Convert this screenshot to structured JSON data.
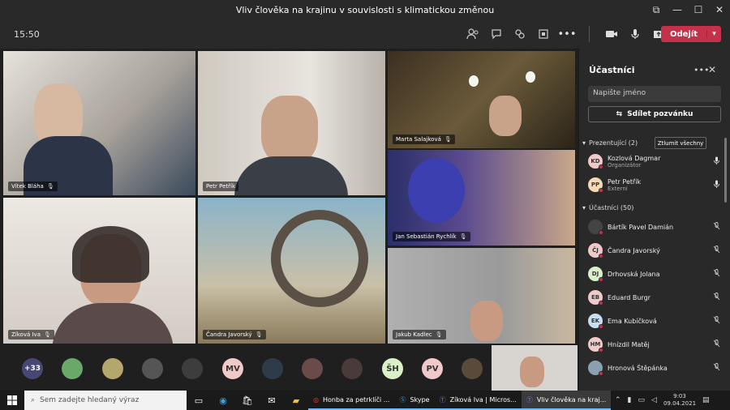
{
  "window": {
    "title": "Vliv člověka na krajinu v souvislosti s klimatickou změnou",
    "controls": [
      "⧉",
      "—",
      "☐",
      "✕"
    ]
  },
  "toolbar": {
    "time": "15:50",
    "leave_label": "Odejít"
  },
  "video_tiles": [
    {
      "name": "Vítek Bláha",
      "bg": "#8a8580"
    },
    {
      "name": "Petr Petřík",
      "bg": "#cfcac3"
    },
    {
      "name": "Marta Salajková",
      "bg": "#4a3b2a"
    },
    {
      "name": "Jan Sebastián Rychlík",
      "bg": "#5a4a6e"
    },
    {
      "name": "Zíková Iva",
      "bg": "#d9d3cc"
    },
    {
      "name": "Čandra Javorský",
      "bg": "#7f8d8a"
    },
    {
      "name": "Jakub Kadlec",
      "bg": "#9b9b9b"
    }
  ],
  "strip": {
    "overflow": "+33",
    "avatars": [
      {
        "initials": "",
        "color": "#6aa86a"
      },
      {
        "initials": "",
        "color": "#b5a76b"
      },
      {
        "initials": "",
        "color": "#555555"
      },
      {
        "initials": "",
        "color": "#3d3d3d"
      },
      {
        "initials": "MV",
        "color": "#f0c9c9"
      },
      {
        "initials": "",
        "color": "#2e3b4a"
      },
      {
        "initials": "",
        "color": "#6b4a4a"
      },
      {
        "initials": "",
        "color": "#4a3a3a"
      },
      {
        "initials": "ŠH",
        "color": "#d9f0c9"
      },
      {
        "initials": "PV",
        "color": "#f0c9c9"
      },
      {
        "initials": "",
        "color": "#5a4a3a"
      }
    ]
  },
  "panel": {
    "title": "Účastníci",
    "search_placeholder": "Napište jméno",
    "invite_label": "Sdílet pozvánku",
    "presenters_label": "Prezentující (2)",
    "mute_all_label": "Ztlumit všechny",
    "attendees_label": "Účastníci (50)",
    "presenters": [
      {
        "initials": "KD",
        "name": "Kozlová Dagmar",
        "sub": "Organizátor",
        "color": "#f0c9c9"
      },
      {
        "initials": "PP",
        "name": "Petr Petřík",
        "sub": "Externí",
        "color": "#f5d9b8"
      }
    ],
    "attendees": [
      {
        "initials": "",
        "name": "Bártík Pavel Damián",
        "color": "#444444"
      },
      {
        "initials": "ČJ",
        "name": "Čandra Javorský",
        "color": "#f0c9c9"
      },
      {
        "initials": "DJ",
        "name": "Drhovská Jolana",
        "color": "#d9f0c9"
      },
      {
        "initials": "EB",
        "name": "Eduard Burgr",
        "color": "#f0c9c9"
      },
      {
        "initials": "EK",
        "name": "Ema Kubíčková",
        "color": "#c9def0"
      },
      {
        "initials": "HM",
        "name": "Hnízdil Matěj",
        "color": "#f0c9c9"
      },
      {
        "initials": "",
        "name": "Hronová Štěpánka",
        "color": "#8aa0b0"
      }
    ]
  },
  "taskbar": {
    "search_placeholder": "Sem zadejte hledaný výraz",
    "apps": [
      {
        "label": "Honba za petrklíči ..."
      },
      {
        "label": "Skype"
      },
      {
        "label": "Zíková Iva | Micros..."
      },
      {
        "label": "Vliv člověka na kraj..."
      }
    ],
    "time": "9:03",
    "date": "09.04.2021"
  }
}
